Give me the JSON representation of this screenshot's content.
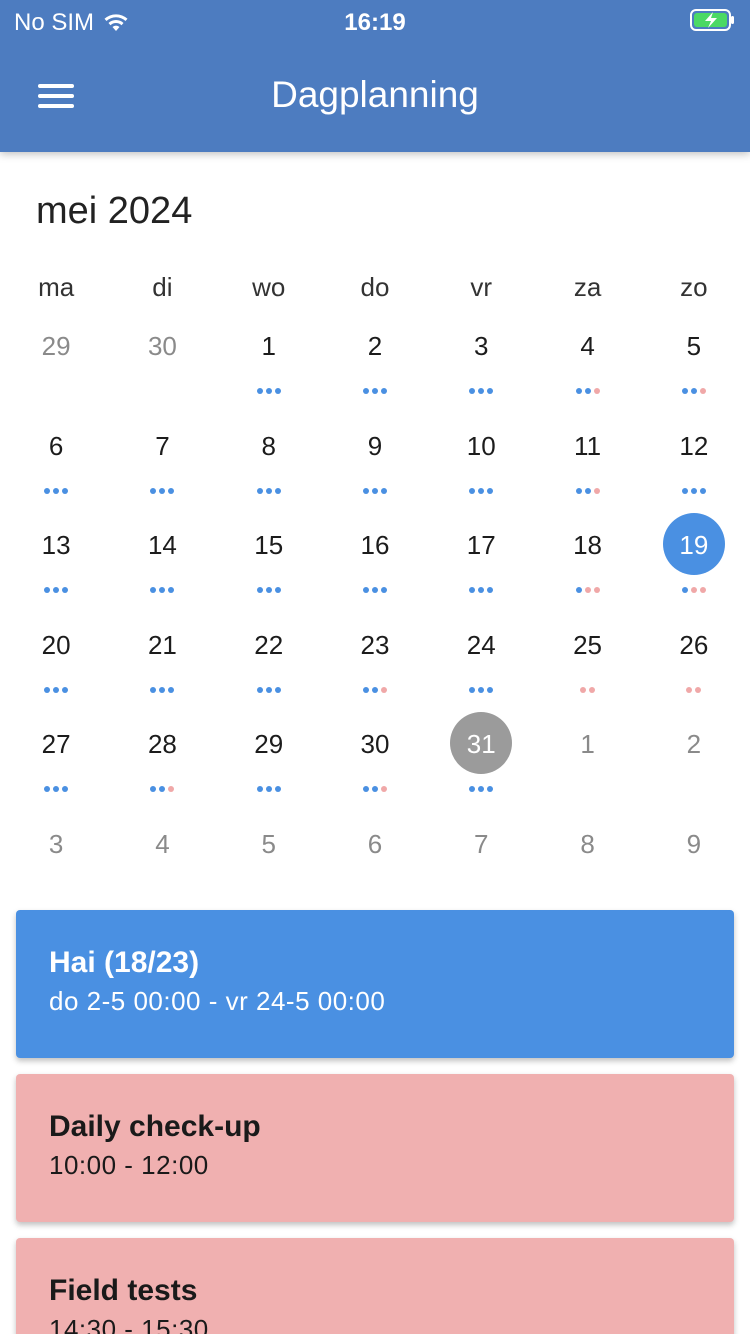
{
  "status_bar": {
    "carrier": "No SIM",
    "time": "16:19"
  },
  "header": {
    "title": "Dagplanning",
    "menu_icon": "hamburger-menu-icon"
  },
  "calendar": {
    "month_label": "mei 2024",
    "weekdays": [
      "ma",
      "di",
      "wo",
      "do",
      "vr",
      "za",
      "zo"
    ],
    "weeks": [
      [
        {
          "day": "29",
          "other": true,
          "dots": []
        },
        {
          "day": "30",
          "other": true,
          "dots": []
        },
        {
          "day": "1",
          "dots": [
            "blue",
            "blue",
            "blue"
          ]
        },
        {
          "day": "2",
          "dots": [
            "blue",
            "blue",
            "blue"
          ]
        },
        {
          "day": "3",
          "dots": [
            "blue",
            "blue",
            "blue"
          ]
        },
        {
          "day": "4",
          "dots": [
            "blue",
            "blue",
            "pink"
          ]
        },
        {
          "day": "5",
          "dots": [
            "blue",
            "blue",
            "pink"
          ]
        }
      ],
      [
        {
          "day": "6",
          "dots": [
            "blue",
            "blue",
            "blue"
          ]
        },
        {
          "day": "7",
          "dots": [
            "blue",
            "blue",
            "blue"
          ]
        },
        {
          "day": "8",
          "dots": [
            "blue",
            "blue",
            "blue"
          ]
        },
        {
          "day": "9",
          "dots": [
            "blue",
            "blue",
            "blue"
          ]
        },
        {
          "day": "10",
          "dots": [
            "blue",
            "blue",
            "blue"
          ]
        },
        {
          "day": "11",
          "dots": [
            "blue",
            "blue",
            "pink"
          ]
        },
        {
          "day": "12",
          "dots": [
            "blue",
            "blue",
            "blue"
          ]
        }
      ],
      [
        {
          "day": "13",
          "dots": [
            "blue",
            "blue",
            "blue"
          ]
        },
        {
          "day": "14",
          "dots": [
            "blue",
            "blue",
            "blue"
          ]
        },
        {
          "day": "15",
          "dots": [
            "blue",
            "blue",
            "blue"
          ]
        },
        {
          "day": "16",
          "dots": [
            "blue",
            "blue",
            "blue"
          ]
        },
        {
          "day": "17",
          "dots": [
            "blue",
            "blue",
            "blue"
          ]
        },
        {
          "day": "18",
          "dots": [
            "blue",
            "pink",
            "pink"
          ]
        },
        {
          "day": "19",
          "selected": true,
          "dots": [
            "blue",
            "pink",
            "pink"
          ]
        }
      ],
      [
        {
          "day": "20",
          "dots": [
            "blue",
            "blue",
            "blue"
          ]
        },
        {
          "day": "21",
          "dots": [
            "blue",
            "blue",
            "blue"
          ]
        },
        {
          "day": "22",
          "dots": [
            "blue",
            "blue",
            "blue"
          ]
        },
        {
          "day": "23",
          "dots": [
            "blue",
            "blue",
            "pink"
          ]
        },
        {
          "day": "24",
          "dots": [
            "blue",
            "blue",
            "blue"
          ]
        },
        {
          "day": "25",
          "dots": [
            "pink",
            "pink"
          ]
        },
        {
          "day": "26",
          "dots": [
            "pink",
            "pink"
          ]
        }
      ],
      [
        {
          "day": "27",
          "dots": [
            "blue",
            "blue",
            "blue"
          ]
        },
        {
          "day": "28",
          "dots": [
            "blue",
            "blue",
            "pink"
          ]
        },
        {
          "day": "29",
          "dots": [
            "blue",
            "blue",
            "blue"
          ]
        },
        {
          "day": "30",
          "dots": [
            "blue",
            "blue",
            "pink"
          ]
        },
        {
          "day": "31",
          "today": true,
          "dots": [
            "blue",
            "blue",
            "blue"
          ]
        },
        {
          "day": "1",
          "other": true,
          "dots": []
        },
        {
          "day": "2",
          "other": true,
          "dots": []
        }
      ],
      [
        {
          "day": "3",
          "other": true,
          "dots": []
        },
        {
          "day": "4",
          "other": true,
          "dots": []
        },
        {
          "day": "5",
          "other": true,
          "dots": []
        },
        {
          "day": "6",
          "other": true,
          "dots": []
        },
        {
          "day": "7",
          "other": true,
          "dots": []
        },
        {
          "day": "8",
          "other": true,
          "dots": []
        },
        {
          "day": "9",
          "other": true,
          "dots": []
        }
      ]
    ]
  },
  "events": [
    {
      "title": "Hai (18/23)",
      "time": "do 2-5 00:00 - vr 24-5 00:00",
      "color": "blue"
    },
    {
      "title": "Daily check-up",
      "time": "10:00 - 12:00",
      "color": "pink"
    },
    {
      "title": "Field tests",
      "time": "14:30 - 15:30",
      "color": "pink"
    }
  ],
  "colors": {
    "header": "#4d7cc0",
    "selected": "#4a90e2",
    "today": "#9b9b9b",
    "event_blue": "#4a90e2",
    "event_pink": "#f0b0b0",
    "dot_blue": "#4a90e2",
    "dot_pink": "#f0a8a8"
  }
}
